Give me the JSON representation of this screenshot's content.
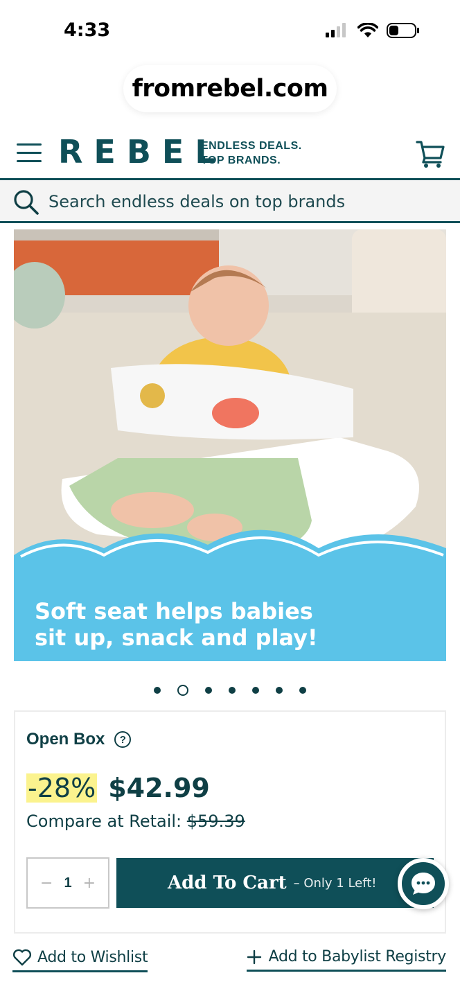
{
  "status_bar": {
    "time": "4:33"
  },
  "browser": {
    "url": "fromrebel.com"
  },
  "header": {
    "logo": "REBEL",
    "tagline_line1": "ENDLESS DEALS.",
    "tagline_line2": "TOP BRANDS."
  },
  "search": {
    "placeholder": "Search endless deals on top brands"
  },
  "product_image": {
    "caption_line1": "Soft seat helps babies",
    "caption_line2": "sit up, snack and play!"
  },
  "carousel": {
    "count": 7,
    "active_index": 1
  },
  "buy_box": {
    "condition": "Open Box",
    "discount": "-28%",
    "price": "$42.99",
    "compare_label": "Compare at Retail:",
    "compare_price": "$59.39",
    "quantity": "1",
    "qty_minus": "−",
    "qty_plus": "+",
    "add_to_cart": "Add To Cart",
    "stock_note": "– Only 1 Left!"
  },
  "links": {
    "wishlist": "Add to Wishlist",
    "registry": "Add to Babylist Registry"
  },
  "colors": {
    "brand": "#0f4f58",
    "highlight": "#fbf38e",
    "caption_bg": "#5bc3e8"
  }
}
